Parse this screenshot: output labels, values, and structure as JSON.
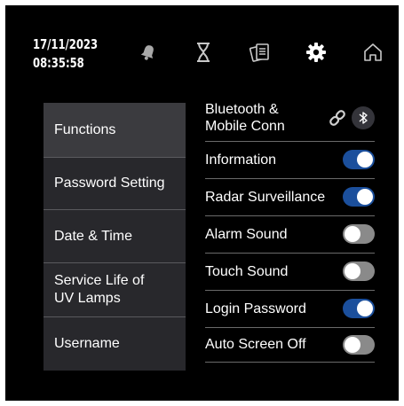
{
  "header": {
    "date": "17/11/2023",
    "time": "08:35:58",
    "icons": [
      "bell-icon",
      "hourglass-icon",
      "documents-icon",
      "gear-icon",
      "home-icon"
    ]
  },
  "menu": {
    "items": [
      {
        "label": "Functions",
        "active": true
      },
      {
        "label": "Password Setting",
        "active": false
      },
      {
        "label": "Date & Time",
        "active": false
      },
      {
        "label": "Service Life of UV Lamps",
        "active": false
      },
      {
        "label": "Username",
        "active": false
      }
    ]
  },
  "settings": [
    {
      "label": "Bluetooth & Mobile Conn",
      "control": "link-bluetooth"
    },
    {
      "label": "Information",
      "enabled": true
    },
    {
      "label": "Radar Surveillance",
      "enabled": true
    },
    {
      "label": "Alarm Sound",
      "enabled": false
    },
    {
      "label": "Touch Sound",
      "enabled": false
    },
    {
      "label": "Login Password",
      "enabled": true
    },
    {
      "label": "Auto Screen Off",
      "enabled": false
    }
  ],
  "colors": {
    "background": "#000000",
    "panel": "#28282c",
    "panel_active": "#3b3b3f",
    "toggle_on": "#1b4f9c",
    "toggle_off": "#8a8a8a"
  }
}
